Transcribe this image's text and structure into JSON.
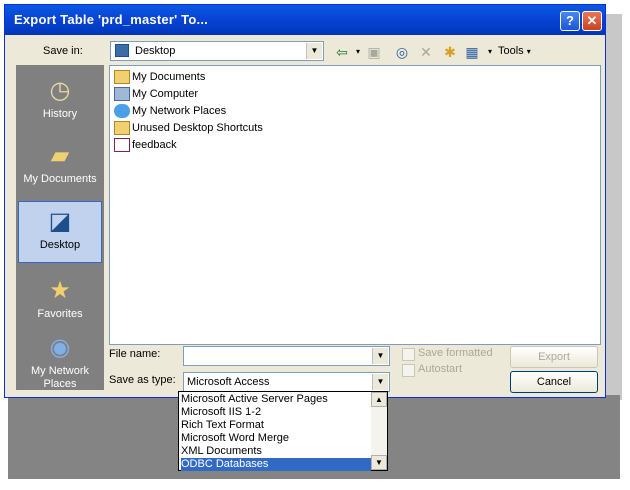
{
  "window": {
    "title": "Export Table 'prd_master' To...",
    "help_label": "?",
    "close_label": "✕"
  },
  "toolbar": {
    "save_in_label": "Save in:",
    "save_in_value": "Desktop",
    "tools_label": "Tools"
  },
  "places": [
    {
      "label": "History",
      "icon": "history-icon"
    },
    {
      "label": "My Documents",
      "icon": "my-documents-icon"
    },
    {
      "label": "Desktop",
      "icon": "desktop-icon"
    },
    {
      "label": "Favorites",
      "icon": "favorites-icon"
    },
    {
      "label": "My Network Places",
      "icon": "network-places-icon"
    }
  ],
  "files": [
    {
      "name": "My Documents",
      "icon": "my-documents-icon"
    },
    {
      "name": "My Computer",
      "icon": "my-computer-icon"
    },
    {
      "name": "My Network Places",
      "icon": "network-places-icon"
    },
    {
      "name": "Unused Desktop Shortcuts",
      "icon": "folder-icon"
    },
    {
      "name": "feedback",
      "icon": "document-icon"
    }
  ],
  "form": {
    "file_name_label": "File name:",
    "file_name_value": "",
    "save_as_type_label": "Save as type:",
    "save_as_type_value": "Microsoft Access",
    "save_formatted_label": "Save formatted",
    "autostart_label": "Autostart",
    "export_label": "Export",
    "cancel_label": "Cancel"
  },
  "type_dropdown": {
    "options": [
      "Microsoft Active Server Pages",
      "Microsoft IIS 1-2",
      "Rich Text Format",
      "Microsoft Word Merge",
      "XML Documents",
      "ODBC Databases"
    ],
    "selected": "ODBC Databases"
  }
}
